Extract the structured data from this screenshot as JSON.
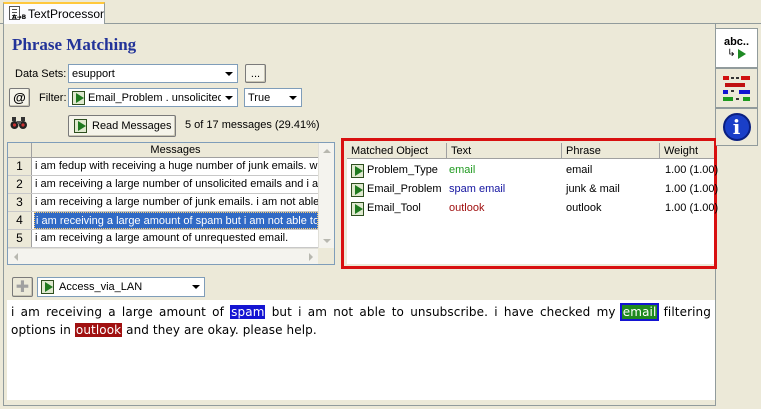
{
  "tab": {
    "label": "TextProcessor"
  },
  "page": {
    "title": "Phrase Matching"
  },
  "datasets": {
    "label": "Data Sets:",
    "value": "esupport",
    "browse_label": "..."
  },
  "filter": {
    "label": "Filter:",
    "value": "Email_Problem . unsolicited",
    "condition": "True"
  },
  "read": {
    "button_label": "Read Messages",
    "status": "5 of 17 messages (29.41%)"
  },
  "messages": {
    "header": "Messages",
    "rows": [
      {
        "num": "1",
        "text": "i am fedup with receiving a huge number of junk emails. what"
      },
      {
        "num": "2",
        "text": "i am receiving a large number of unsolicited emails and i am..."
      },
      {
        "num": "3",
        "text": "i am receiving a large number of junk emails. i am not able ..."
      },
      {
        "num": "4",
        "text": "i am receiving a large amount of spam but i am not able to u..."
      },
      {
        "num": "5",
        "text": "i am receiving a large amount of unrequested email."
      }
    ]
  },
  "matches": {
    "headers": {
      "object": "Matched Object",
      "text": "Text",
      "phrase": "Phrase",
      "weight": "Weight"
    },
    "rows": [
      {
        "object": "Problem_Type",
        "text": "email",
        "text_color": "#1f9a1f",
        "phrase": "email",
        "weight": "1.00 (1.00)"
      },
      {
        "object": "Email_Problem",
        "text": "spam email",
        "text_color": "#1414a0",
        "phrase": "junk & mail",
        "weight": "1.00 (1.00)"
      },
      {
        "object": "Email_Tool",
        "text": "outlook",
        "text_color": "#a01010",
        "phrase": "outlook",
        "weight": "1.00 (1.00)"
      }
    ]
  },
  "category": {
    "value": "Access_via_LAN"
  },
  "message_text": {
    "segments": [
      {
        "text": "i am receiving a large amount of ",
        "style": "plain"
      },
      {
        "text": "spam",
        "style": "blue"
      },
      {
        "text": " but i am not able to unsubscribe. i have checked my ",
        "style": "plain"
      },
      {
        "text": "email",
        "style": "green"
      },
      {
        "text": " filtering options in ",
        "style": "plain"
      },
      {
        "text": "outlook",
        "style": "red"
      },
      {
        "text": " and they are okay. please help.",
        "style": "plain"
      }
    ]
  },
  "side_buttons": [
    {
      "icon": "abc-play-icon",
      "text": "abc.."
    },
    {
      "icon": "colored-bars-icon"
    },
    {
      "icon": "info-icon",
      "text": "i"
    }
  ],
  "colors": {
    "accent": "#223399",
    "frame": "#d81010",
    "selection": "#316ac5"
  }
}
